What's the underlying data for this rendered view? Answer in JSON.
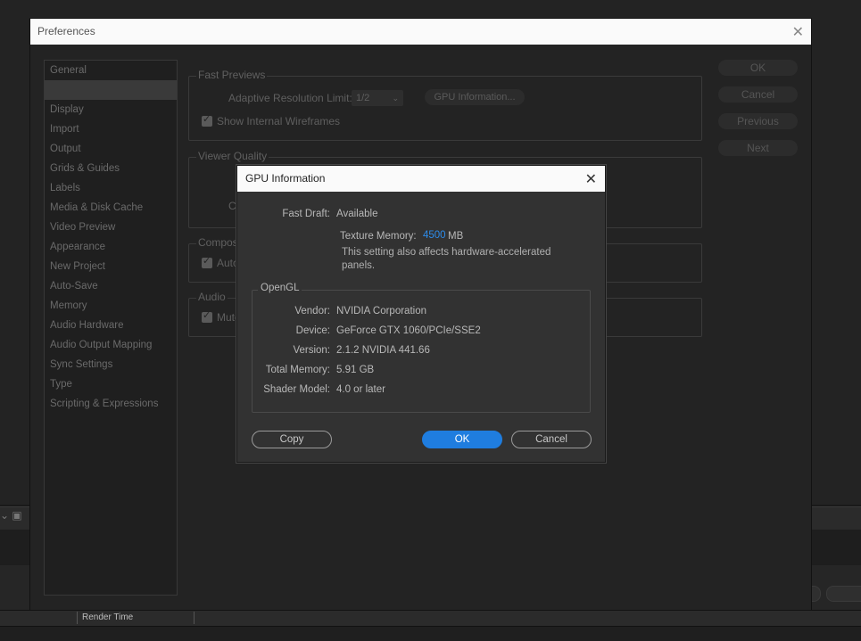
{
  "preferences": {
    "title": "Preferences",
    "sidebar_items": [
      "General",
      "",
      "Display",
      "Import",
      "Output",
      "Grids & Guides",
      "Labels",
      "Media & Disk Cache",
      "Video Preview",
      "Appearance",
      "New Project",
      "Auto-Save",
      "Memory",
      "Audio Hardware",
      "Audio Output Mapping",
      "Sync Settings",
      "Type",
      "Scripting & Expressions"
    ],
    "selected_index": 1,
    "fast_previews": {
      "legend": "Fast Previews",
      "adaptive_label": "Adaptive Resolution Limit:",
      "adaptive_value": "1/2",
      "gpu_info_button": "GPU Information...",
      "wireframes_label": "Show Internal Wireframes"
    },
    "viewer_quality": {
      "legend": "Viewer Quality",
      "partial_label": "Co"
    },
    "composition": {
      "legend": "Composit",
      "auto_label": "Auto"
    },
    "audio": {
      "legend": "Audio",
      "mute_label": "Mute"
    },
    "buttons": {
      "ok": "OK",
      "cancel": "Cancel",
      "previous": "Previous",
      "next": "Next"
    }
  },
  "gpu_dialog": {
    "title": "GPU Information",
    "fast_draft_label": "Fast Draft:",
    "fast_draft_value": "Available",
    "texture_memory_label": "Texture Memory:",
    "texture_memory_value": "4500",
    "texture_memory_unit": "MB",
    "note": "This setting also affects hardware-accelerated panels.",
    "opengl_legend": "OpenGL",
    "vendor_label": "Vendor:",
    "vendor_value": "NVIDIA Corporation",
    "device_label": "Device:",
    "device_value": "GeForce GTX 1060/PCIe/SSE2",
    "version_label": "Version:",
    "version_value": "2.1.2 NVIDIA 441.66",
    "total_memory_label": "Total Memory:",
    "total_memory_value": "5.91 GB",
    "shader_model_label": "Shader Model:",
    "shader_model_value": "4.0 or later",
    "copy_button": "Copy",
    "ok_button": "OK",
    "cancel_button": "Cancel"
  },
  "background": {
    "render_time_label": "Render Time"
  },
  "colors": {
    "accent": "#1f7ddf",
    "accent_text": "#2d8ceb",
    "title_bar": "#fafafa"
  }
}
